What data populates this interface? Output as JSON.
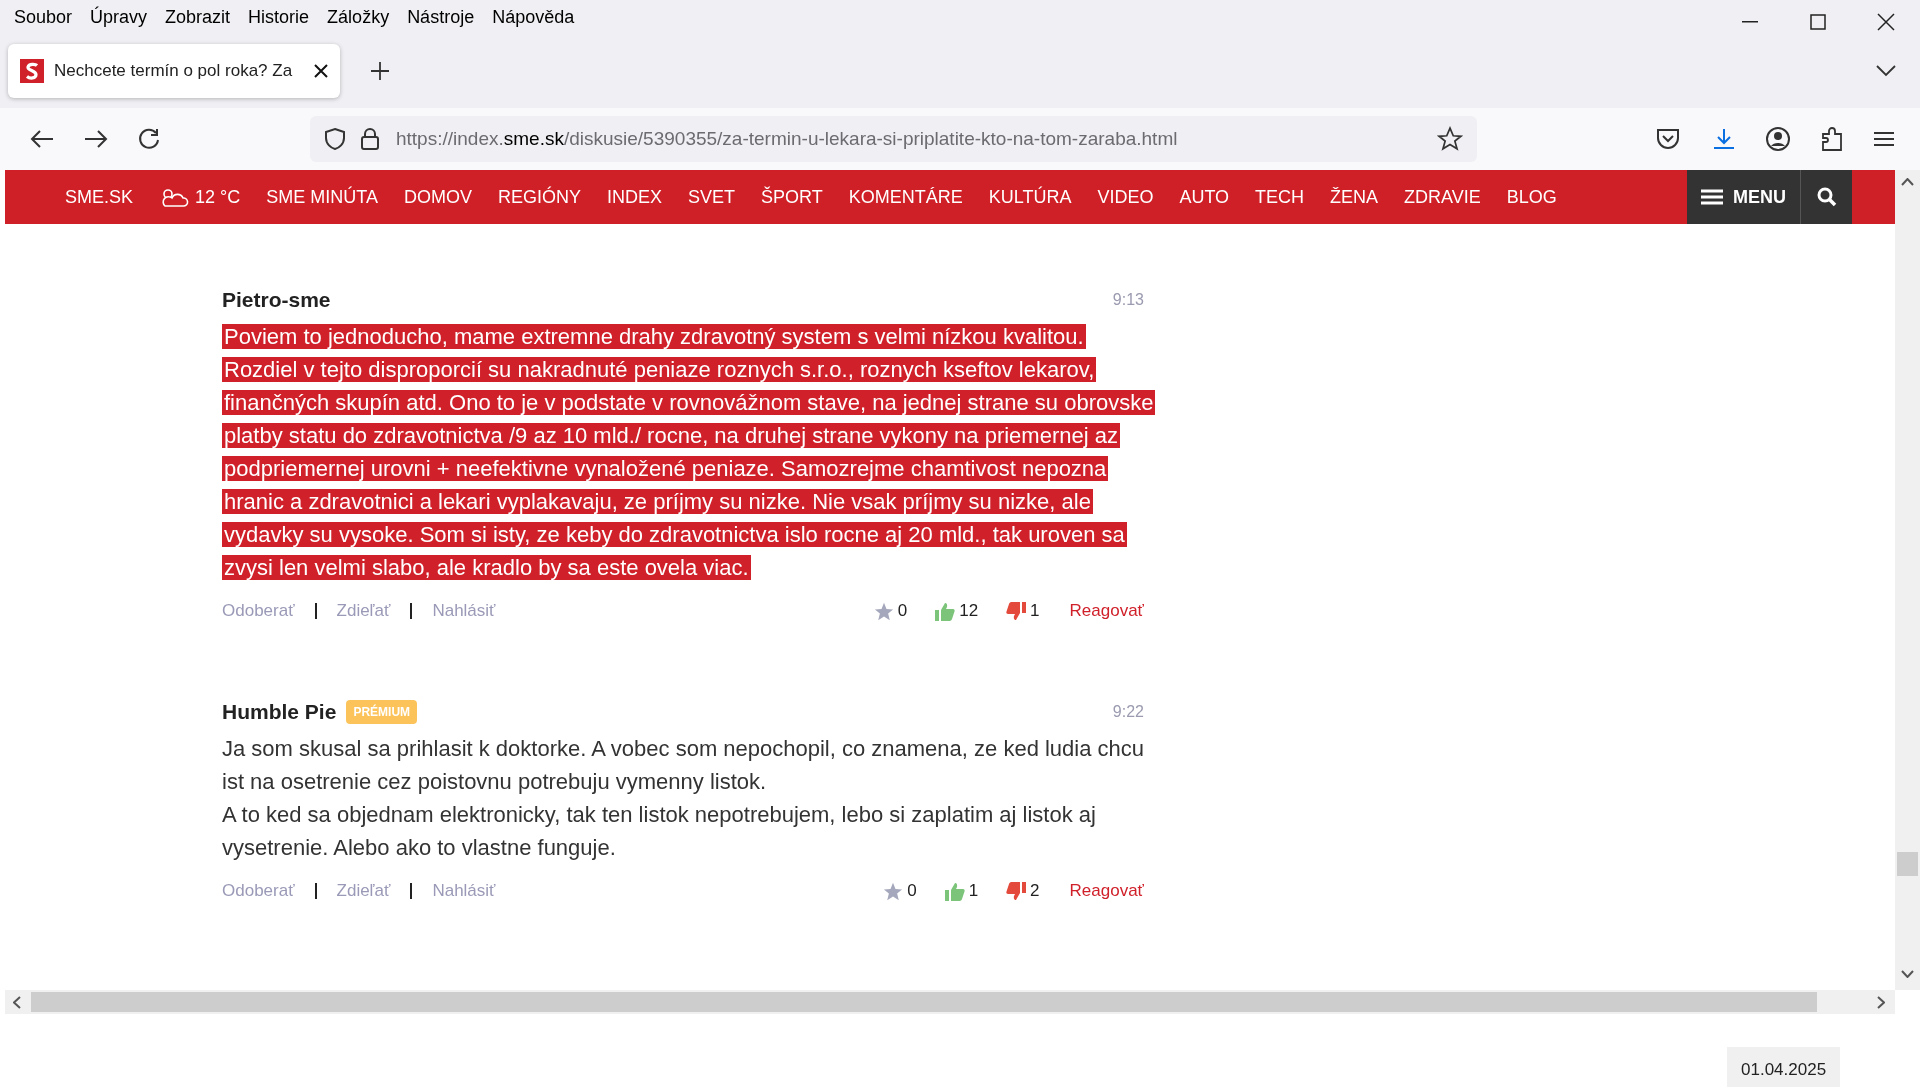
{
  "menu_bar": [
    "Soubor",
    "Úpravy",
    "Zobrazit",
    "Historie",
    "Záložky",
    "Nástroje",
    "Nápověda"
  ],
  "tab": {
    "title": "Nechcete termín o pol roka? Za",
    "selected": true
  },
  "address_bar": {
    "prefix": "https://index.",
    "domain": "sme.sk",
    "path": "/diskusie/5390355/za-termin-u-lekara-si-priplatite-kto-na-tom-zaraba.html"
  },
  "nav": {
    "logo": "SME.SK",
    "weather": "12 °C",
    "items": [
      "SME MINÚTA",
      "DOMOV",
      "REGIÓNY",
      "INDEX",
      "SVET",
      "ŠPORT",
      "KOMENTÁRE",
      "KULTÚRA",
      "VIDEO",
      "AUTO",
      "TECH",
      "ŽENA",
      "ZDRAVIE",
      "BLOG"
    ],
    "menu": "MENU"
  },
  "comments": [
    {
      "author": "Pietro-sme",
      "time": "9:13",
      "selected": true,
      "paragraphs": [
        "Poviem to jednoducho, mame extremne drahy zdravotný system s velmi nízkou kvalitou. Rozdiel v tejto disproporcií su nakradnuté peniaze roznych s.r.o., roznych kseftov lekarov, finančných skupín atd. Ono to je v podstate v rovnovážnom stave, na jednej strane su obrovske platby statu do zdravotnictva /9 az 10 mld./ rocne, na druhej strane vykony na priemernej az podpriemernej urovni + neefektivne vynaložené peniaze. Samozrejme chamtivost nepozna hranic a zdravotnici a lekari vyplakavaju, ze príjmy su nizke. Nie vsak príjmy su nizke, ale vydavky su vysoke. Som si isty, ze keby do zdravotnictva islo rocne aj 20 mld., tak uroven sa zvysi len velmi slabo, ale kradlo by sa este ovela viac."
      ],
      "actions": [
        "Odoberať",
        "Zdieľať",
        "Nahlásiť"
      ],
      "stars": "0",
      "likes": "12",
      "dislikes": "1",
      "reply": "Reagovať"
    },
    {
      "author": "Humble Pie",
      "badge": "PRÉMIUM",
      "time": "9:22",
      "selected": false,
      "paragraphs": [
        "Ja som skusal sa prihlasit k doktorke. A vobec som nepochopil, co znamena, ze ked ludia chcu ist na osetrenie cez poistovnu potrebuju vymenny listok.",
        "A to ked sa objednam elektronicky, tak ten listok nepotrebujem, lebo si zaplatim aj listok aj vysetrenie. Alebo ako to vlastne funguje."
      ],
      "actions": [
        "Odoberať",
        "Zdieľať",
        "Nahlásiť"
      ],
      "stars": "0",
      "likes": "1",
      "dislikes": "2",
      "reply": "Reagovať"
    }
  ],
  "date": "01.04.2025"
}
